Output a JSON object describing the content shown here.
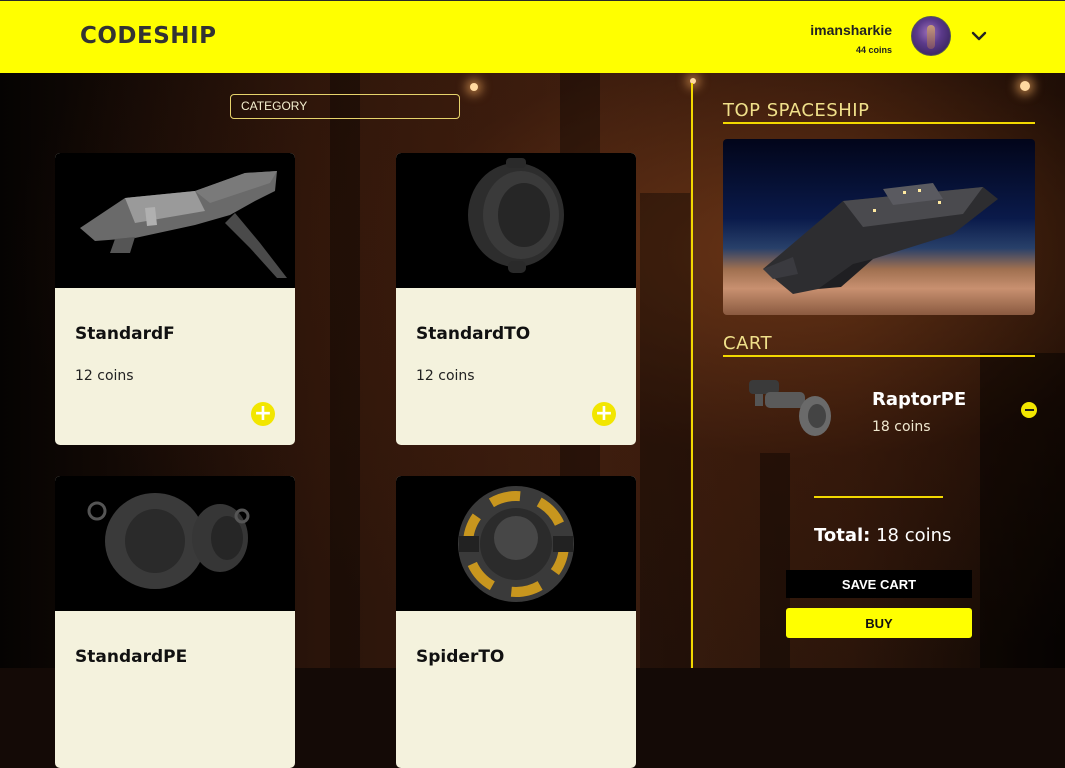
{
  "header": {
    "logo": "CODESHIP",
    "username": "imansharkie",
    "coins": "44 coins"
  },
  "filter": {
    "category_label": "CATEGORY"
  },
  "products": [
    {
      "name": "StandardF",
      "price": "12  coins",
      "icon": "spaceship-hull-image"
    },
    {
      "name": "StandardTO",
      "price": "12  coins",
      "icon": "round-thruster-image"
    },
    {
      "name": "StandardPE",
      "price": "",
      "icon": "twin-engine-image"
    },
    {
      "name": "SpiderTO",
      "price": "",
      "icon": "ring-thruster-image"
    }
  ],
  "top_spaceship": {
    "title": "TOP SPACESHIP"
  },
  "cart": {
    "title": "CART",
    "items": [
      {
        "name": "RaptorPE",
        "price": "18 coins"
      }
    ],
    "total_label": "Total:",
    "total_value": "18 coins",
    "save_label": "SAVE CART",
    "buy_label": "BUY"
  },
  "colors": {
    "accent": "#ffff00",
    "card_bg": "#f4f2dd"
  }
}
